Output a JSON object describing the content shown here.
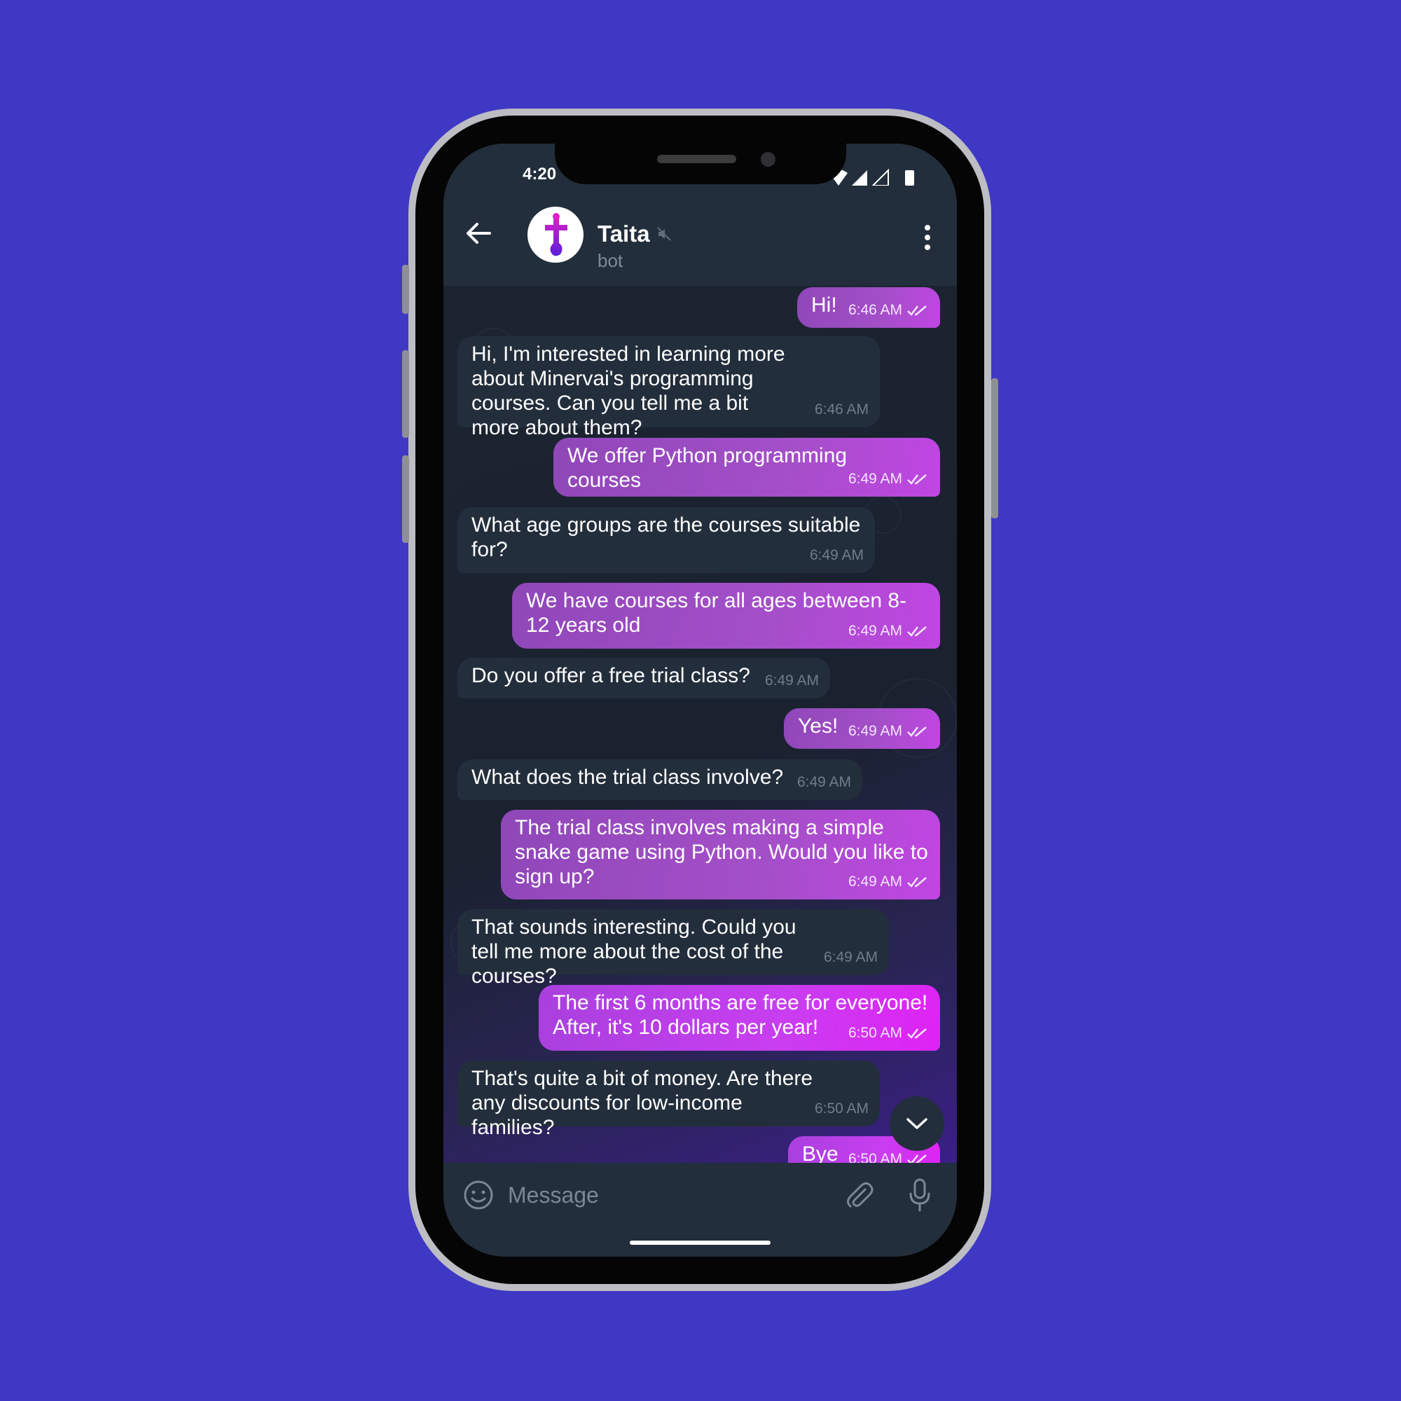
{
  "status_bar": {
    "time": "4:20"
  },
  "header": {
    "contact_name": "Taita",
    "contact_subtitle": "bot"
  },
  "messages": [
    {
      "side": "out",
      "text": "Hi!",
      "time": "6:46 AM"
    },
    {
      "side": "in",
      "text": "Hi, I'm interested in learning more about Minervai's programming courses. Can you tell me a bit more about them?",
      "time": "6:46 AM"
    },
    {
      "side": "out",
      "text": "We offer Python programming courses",
      "time": "6:49 AM"
    },
    {
      "side": "in",
      "text": "What age groups are the courses suitable for?",
      "time": "6:49 AM"
    },
    {
      "side": "out",
      "text": "We have courses for all ages between 8-12 years old",
      "time": "6:49 AM"
    },
    {
      "side": "in",
      "text": "Do you offer a free trial class?",
      "time": "6:49 AM"
    },
    {
      "side": "out",
      "text": "Yes!",
      "time": "6:49 AM"
    },
    {
      "side": "in",
      "text": "What does the trial class involve?",
      "time": "6:49 AM"
    },
    {
      "side": "out",
      "text": "The trial class involves making a simple snake game using Python. Would you like to sign up?",
      "time": "6:49 AM"
    },
    {
      "side": "in",
      "text": "That sounds interesting. Could you tell me more about the cost of the courses?",
      "time": "6:49 AM"
    },
    {
      "side": "out",
      "text": "The first 6 months are free for everyone! After, it's 10 dollars per year!",
      "time": "6:50 AM"
    },
    {
      "side": "in",
      "text": "That's quite a bit of money. Are there any discounts for low-income families?",
      "time": "6:50 AM"
    },
    {
      "side": "out",
      "text": "Bye",
      "time": "6:50 AM"
    }
  ],
  "composer": {
    "placeholder": "Message"
  },
  "colors": {
    "background": "#3f38c4",
    "incoming_bubble": "#232e3c",
    "outgoing_bubble": "#a44fc8",
    "header": "#222e3b"
  }
}
